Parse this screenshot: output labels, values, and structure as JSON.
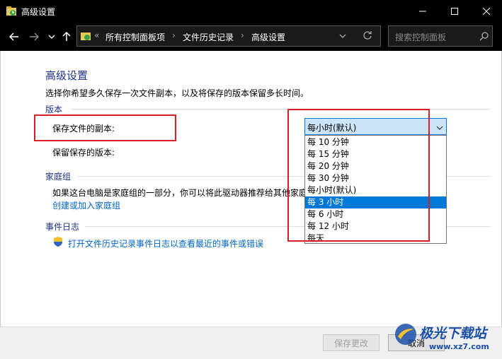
{
  "window": {
    "title": "高级设置",
    "controls": [
      "minimize-icon",
      "maximize-icon",
      "close-icon"
    ]
  },
  "address_bar": {
    "overflow": "«",
    "breadcrumbs": [
      "所有控制面板项",
      "文件历史记录",
      "高级设置"
    ],
    "separator": "›"
  },
  "search": {
    "placeholder": "搜索控制面板"
  },
  "page": {
    "title": "高级设置",
    "description": "选择你希望多久保存一次文件副本，以及将保存的版本保留多长时间。"
  },
  "versions": {
    "heading": "版本",
    "save_copies_label": "保存文件的副本:",
    "keep_versions_label": "保留保存的版本:",
    "dropdown": {
      "selected": "每小时(默认)",
      "options": [
        "每 10 分钟",
        "每 15 分钟",
        "每 20 分钟",
        "每 30 分钟",
        "每小时(默认)",
        "每 3 小时",
        "每 6 小时",
        "每 12 小时",
        "每天"
      ],
      "highlighted": "每 3 小时"
    }
  },
  "homegroup": {
    "heading": "家庭组",
    "text": "如果这台电脑是家庭组的一部分，你可以将此驱动器推荐给其他家庭",
    "link": "创建或加入家庭组"
  },
  "event_log": {
    "heading": "事件日志",
    "link": "打开文件历史记录事件日志以查看最近的事件或错误",
    "icon": "uac-shield-icon"
  },
  "footer": {
    "save_button": "保存更改",
    "cancel_button": "取消"
  },
  "watermark": {
    "name": "极光下载站",
    "url": "www.xz7.com"
  },
  "colors": {
    "accent": "#0078d7",
    "heading": "#1e3287",
    "link": "#0066cc",
    "annotation": "#d9202a",
    "titlebar": "#000000"
  }
}
